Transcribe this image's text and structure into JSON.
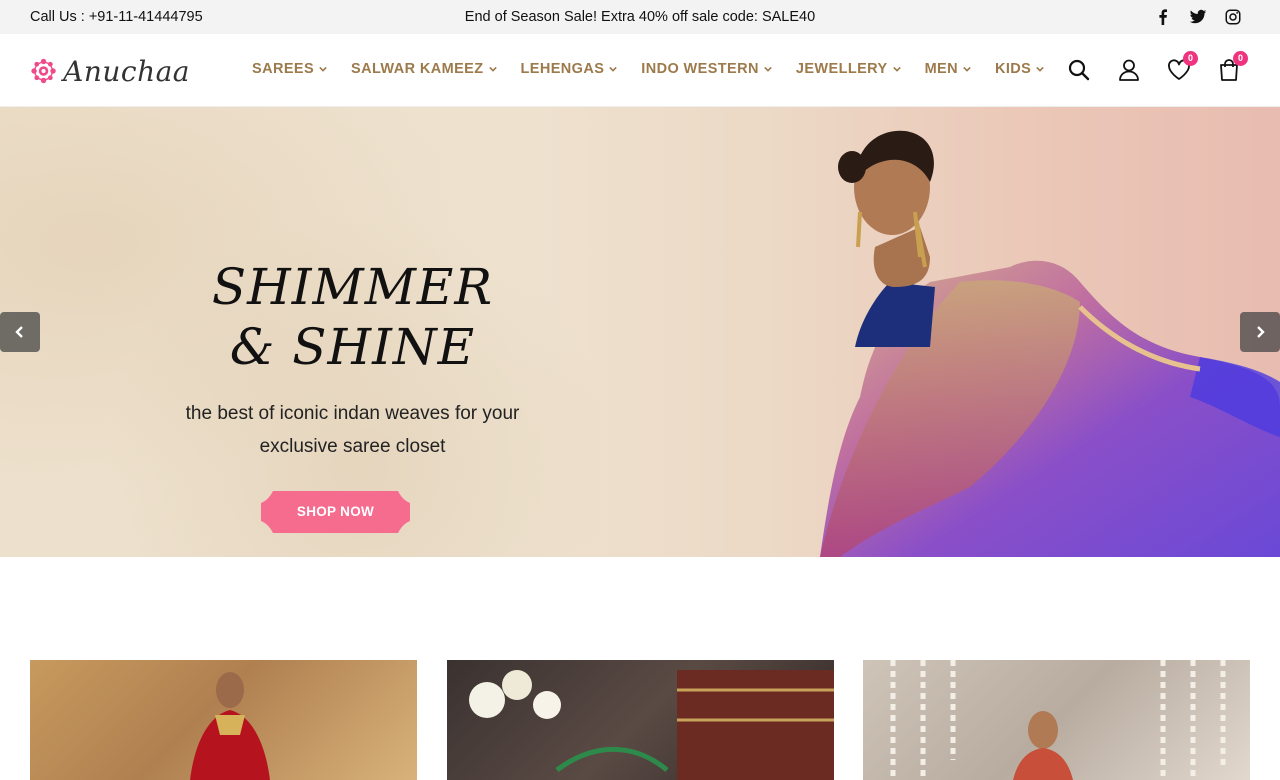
{
  "topbar": {
    "call": "Call Us : +91-11-41444795",
    "promo": "End of Season Sale! Extra 40% off sale code: SALE40",
    "social": [
      "facebook-icon",
      "twitter-icon",
      "instagram-icon"
    ]
  },
  "header": {
    "logo_text": "Anuchaa",
    "nav": [
      "SAREES",
      "SALWAR KAMEEZ",
      "LEHENGAS",
      "INDO WESTERN",
      "JEWELLERY",
      "MEN",
      "KIDS"
    ],
    "wishlist_count": "0",
    "cart_count": "0"
  },
  "hero": {
    "headline_1": "SHIMMER",
    "headline_2": "& SHINE",
    "sub_1": "the best of iconic indan weaves for your",
    "sub_2": "exclusive saree closet",
    "cta": "SHOP NOW"
  },
  "colors": {
    "accent_pink": "#f0337f",
    "nav_gold": "#9c7a4b",
    "topbar_bg": "#f3f3f3"
  }
}
